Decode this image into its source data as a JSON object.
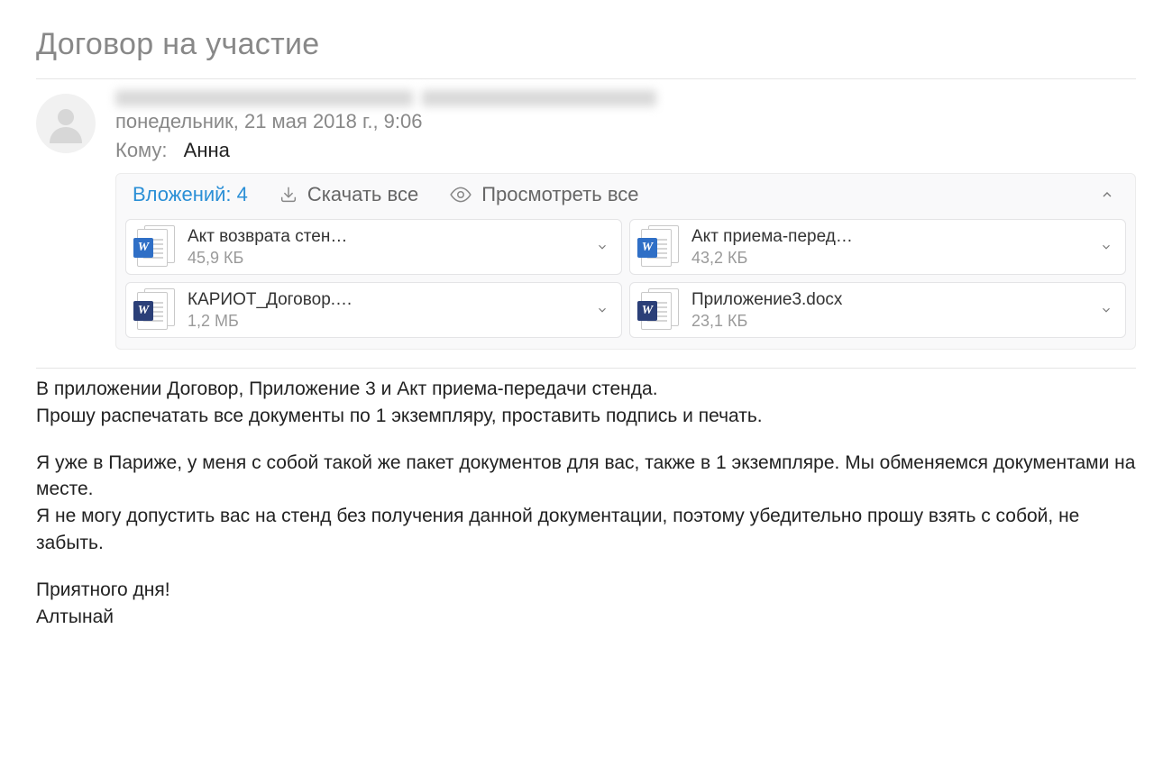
{
  "subject": "Договор на участие",
  "sender_hidden": true,
  "date": "понедельник, 21 мая 2018 г., 9:06",
  "to_label": "Кому:",
  "to_name": "Анна",
  "attachments": {
    "count_label": "Вложений: 4",
    "download_all": "Скачать все",
    "preview_all": "Просмотреть все",
    "items": [
      {
        "name": "Акт возврата стен…",
        "size": "45,9 КБ",
        "icon": "word-light"
      },
      {
        "name": "Акт приема-перед…",
        "size": "43,2 КБ",
        "icon": "word-light"
      },
      {
        "name": "КАРИОТ_Договор.…",
        "size": "1,2 МБ",
        "icon": "word-dark"
      },
      {
        "name": "Приложение3.docx",
        "size": "23,1 КБ",
        "icon": "word-dark"
      }
    ]
  },
  "body": {
    "p1": "В приложении Договор, Приложение 3 и Акт приема-передачи стенда.",
    "p2": "Прошу распечатать все документы по 1 экземпляру, проставить подпись и печать.",
    "p3": "Я уже в Париже, у меня с собой такой же пакет документов для вас, также в 1 экземпляре. Мы обменяемся документами на месте.",
    "p4": "Я не могу допустить вас на стенд без получения данной документации, поэтому убедительно прошу взять с собой, не забыть.",
    "p5": "Приятного дня!",
    "p6": "Алтынай"
  }
}
